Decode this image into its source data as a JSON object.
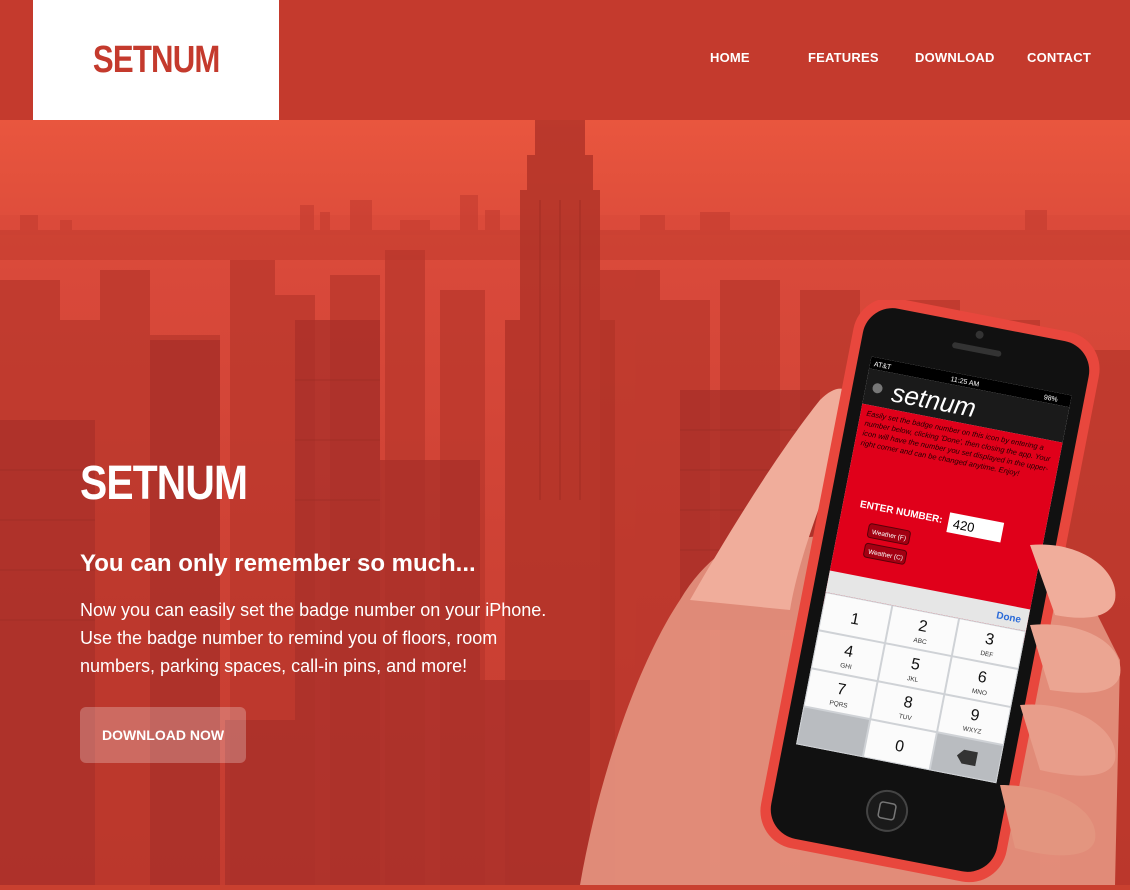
{
  "header": {
    "logo": "SETNUM",
    "nav": [
      {
        "label": "HOME"
      },
      {
        "label": "FEATURES"
      },
      {
        "label": "DOWNLOAD"
      },
      {
        "label": "CONTACT"
      }
    ]
  },
  "hero": {
    "title": "SETNUM",
    "subtitle": "You can only remember so much...",
    "description": "Now you can easily set the badge number on your iPhone. Use the badge number to remind you of floors, room numbers, parking spaces, call-in pins, and more!",
    "cta": "DOWNLOAD NOW"
  },
  "phone": {
    "status": {
      "carrier": "AT&T",
      "time": "11:25 AM",
      "battery": "98%"
    },
    "app_title": "setnum",
    "instructions": "Easily set the badge number on this icon by entering a number below, clicking 'Done', then closing the app. Your icon will have the number you set displayed in the upper-right corner and can be changed anytime. Enjoy!",
    "enter_label": "ENTER NUMBER:",
    "number_value": "420",
    "weather_f": "Weather (F)",
    "weather_c": "Weather (C)",
    "done": "Done",
    "keys": [
      {
        "num": "1",
        "letters": ""
      },
      {
        "num": "2",
        "letters": "ABC"
      },
      {
        "num": "3",
        "letters": "DEF"
      },
      {
        "num": "4",
        "letters": "GHI"
      },
      {
        "num": "5",
        "letters": "JKL"
      },
      {
        "num": "6",
        "letters": "MNO"
      },
      {
        "num": "7",
        "letters": "PQRS"
      },
      {
        "num": "8",
        "letters": "TUV"
      },
      {
        "num": "9",
        "letters": "WXYZ"
      },
      {
        "num": "0",
        "letters": ""
      }
    ]
  },
  "colors": {
    "brand_red": "#c43a2d",
    "hero_top": "#e9563e",
    "phone_case": "#e8473d",
    "app_red": "#e0001a"
  }
}
